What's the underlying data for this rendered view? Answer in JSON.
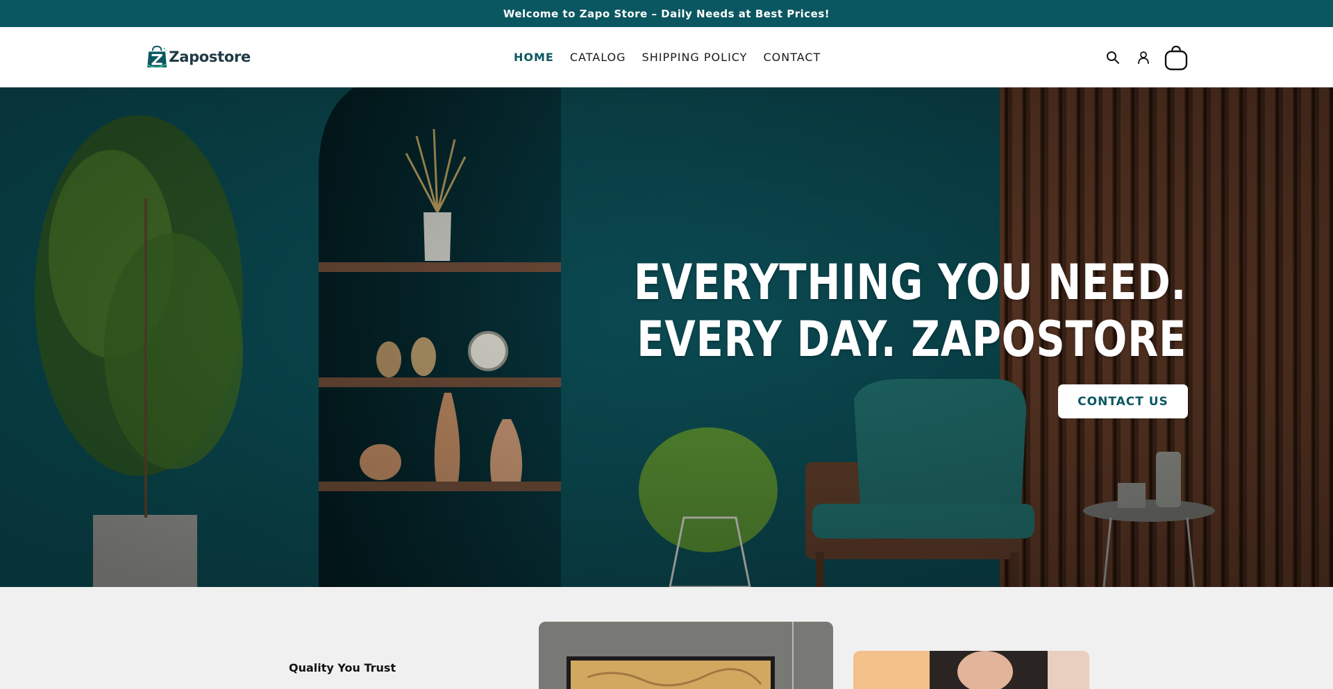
{
  "announcement": {
    "text": "Welcome to Zapo Store – Daily Needs at Best Prices!"
  },
  "brand": {
    "name": "Zapostore",
    "accent": "#0b5761"
  },
  "nav": {
    "items": [
      {
        "label": "HOME",
        "active": true
      },
      {
        "label": "CATALOG",
        "active": false
      },
      {
        "label": "SHIPPING POLICY",
        "active": false
      },
      {
        "label": "CONTACT",
        "active": false
      }
    ]
  },
  "header_icons": [
    "search-icon",
    "account-icon",
    "cart-icon"
  ],
  "hero": {
    "line1": "EVERYTHING YOU NEED.",
    "line2": "EVERY DAY. ZAPOSTORE",
    "cta": "CONTACT US"
  },
  "section": {
    "heading": "Quality You Trust"
  }
}
